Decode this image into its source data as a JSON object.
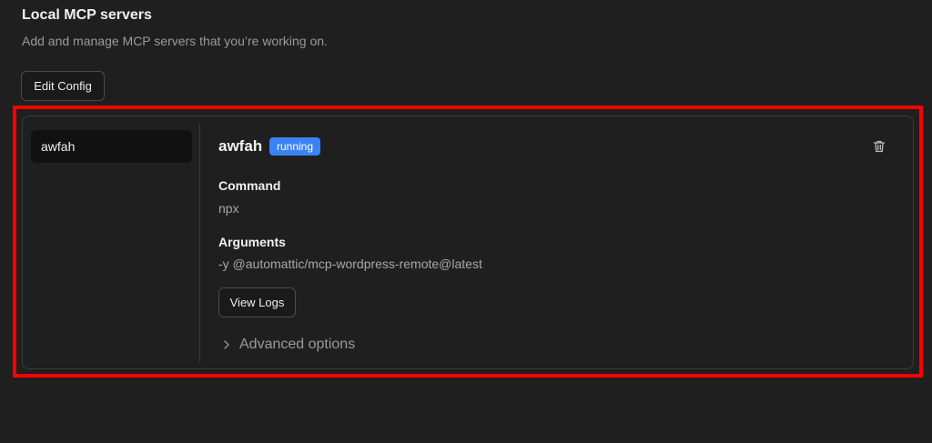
{
  "header": {
    "title": "Local MCP servers",
    "subtitle": "Add and manage MCP servers that you’re working on."
  },
  "toolbar": {
    "edit_config_label": "Edit Config"
  },
  "sidebar": {
    "items": [
      {
        "label": "awfah",
        "selected": true
      }
    ]
  },
  "server": {
    "name": "awfah",
    "status": "running",
    "status_color": "#3b82f6",
    "delete_icon": "trash-icon",
    "command_label": "Command",
    "command_value": "npx",
    "arguments_label": "Arguments",
    "arguments_value": "-y @automattic/mcp-wordpress-remote@latest",
    "view_logs_label": "View Logs",
    "advanced_label": "Advanced options",
    "advanced_icon": "chevron-right-icon"
  },
  "highlight_color": "#ff0000"
}
